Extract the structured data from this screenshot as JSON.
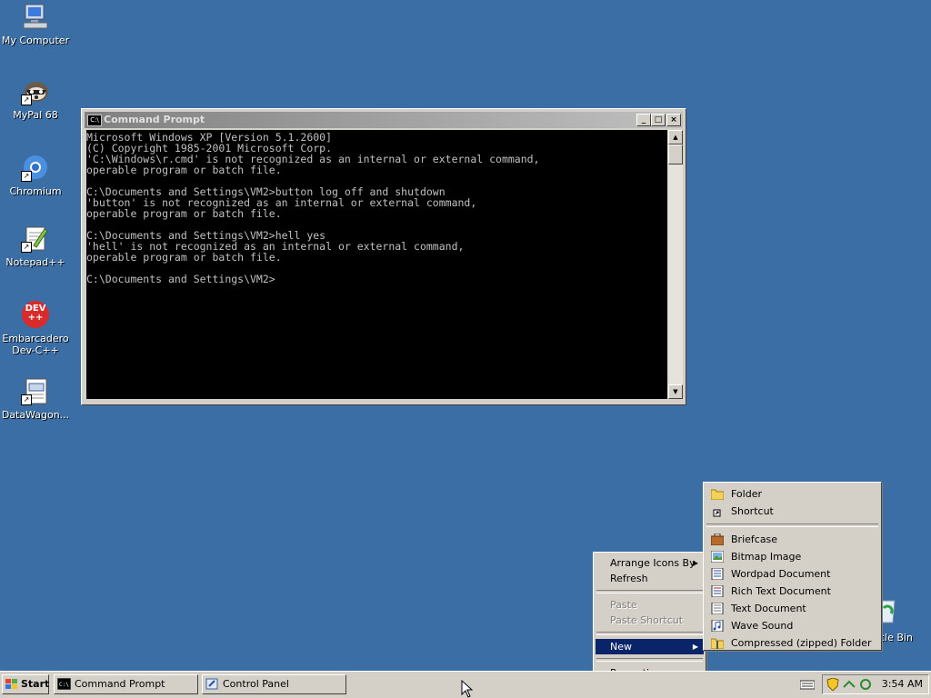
{
  "desktop": {
    "icons": [
      {
        "label": "My Computer",
        "icon": "my-computer-icon"
      },
      {
        "label": "MyPal 68",
        "icon": "mypal-browser-icon"
      },
      {
        "label": "Chromium",
        "icon": "chromium-icon"
      },
      {
        "label": "Notepad++",
        "icon": "notepad-plus-plus-icon"
      },
      {
        "label": "Embarcadero Dev-C++",
        "icon": "dev-cpp-icon",
        "badge": "DEV ++"
      },
      {
        "label": "DataWagon...",
        "icon": "datawagon-icon"
      }
    ],
    "recycle_bin_label": "cle Bin"
  },
  "console_window": {
    "title": "Command Prompt",
    "icon_text": "C:\\",
    "minimize": "_",
    "maximize": "□",
    "close": "×",
    "lines": "Microsoft Windows XP [Version 5.1.2600]\n(C) Copyright 1985-2001 Microsoft Corp.\n'C:\\Windows\\r.cmd' is not recognized as an internal or external command,\noperable program or batch file.\n\nC:\\Documents and Settings\\VM2>button log off and shutdown\n'button' is not recognized as an internal or external command,\noperable program or batch file.\n\nC:\\Documents and Settings\\VM2>hell yes\n'hell' is not recognized as an internal or external command,\noperable program or batch file.\n\nC:\\Documents and Settings\\VM2>"
  },
  "context_menu": {
    "arrange_icons_by": "Arrange Icons By",
    "refresh": "Refresh",
    "paste": "Paste",
    "paste_shortcut": "Paste Shortcut",
    "new": "New",
    "properties": "Properties"
  },
  "new_submenu": {
    "folder": "Folder",
    "shortcut": "Shortcut",
    "briefcase": "Briefcase",
    "bitmap_image": "Bitmap Image",
    "wordpad_document": "Wordpad Document",
    "rich_text_document": "Rich Text Document",
    "text_document": "Text Document",
    "wave_sound": "Wave Sound",
    "compressed_folder": "Compressed (zipped) Folder"
  },
  "taskbar": {
    "start_label": "Start",
    "buttons": [
      {
        "label": "Command Prompt",
        "icon": "command-prompt-icon"
      },
      {
        "label": "Control Panel",
        "icon": "control-panel-icon"
      }
    ],
    "clock": "3:54 AM"
  },
  "colors": {
    "desktop_bg": "#3a6ea5",
    "menu_highlight": "#0a246a",
    "chrome": "#d4d0c8"
  }
}
